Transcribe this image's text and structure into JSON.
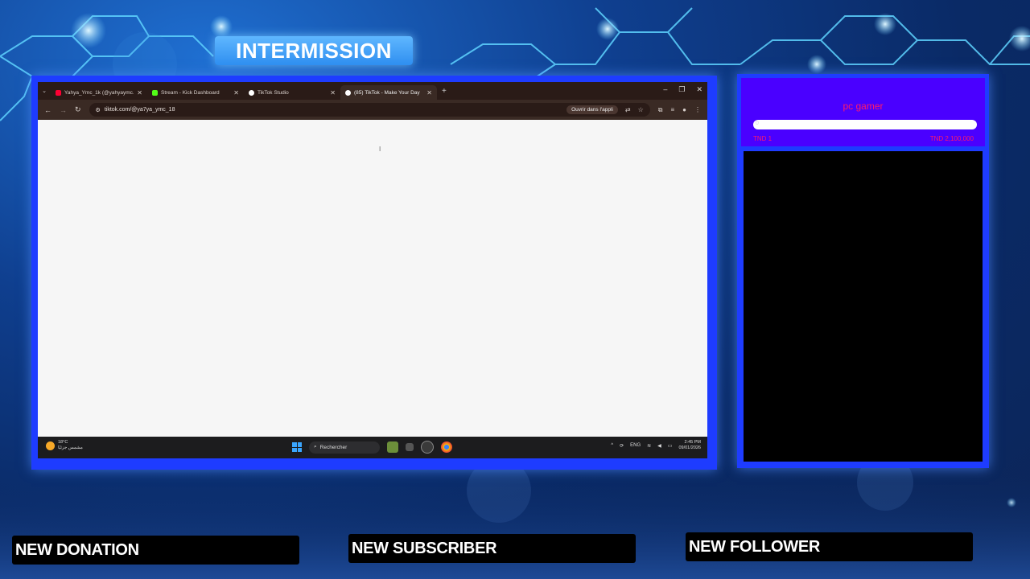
{
  "overlay": {
    "title": "INTERMISSION",
    "alerts": {
      "donation": "NEW DONATION",
      "subscriber": "NEW SUBSCRIBER",
      "follower": "NEW FOLLOWER"
    },
    "goal": {
      "title": "pc gamer",
      "current": "0",
      "progress": 0,
      "start_label": "TND 1",
      "end_label": "TND 2,100,000",
      "accent_color": "#ff1a6a"
    }
  },
  "browser": {
    "tabs": [
      {
        "label": "Yahya_Ymc_1k (@yahyaymc...",
        "icon": "youtube-icon",
        "color": "#ff0033",
        "active": false
      },
      {
        "label": "Stream - Kick Dashboard",
        "icon": "kick-icon",
        "color": "#53fc18",
        "active": false
      },
      {
        "label": "TikTok Studio",
        "icon": "tiktok-icon",
        "color": "#ffffff",
        "active": false
      },
      {
        "label": "(85) TikTok - Make Your Day",
        "icon": "tiktok-icon",
        "color": "#ffffff",
        "active": true
      }
    ],
    "address": "tiktok.com/@ya7ya_ymc_18",
    "open_in_app": "Ouvrir dans l'appli"
  },
  "taskbar": {
    "temperature": "18°C",
    "weather_desc": "مشمس جزئيًا",
    "search_placeholder": "Rechercher",
    "language": "ENG",
    "time": "2:45 PM",
    "date": "09/01/2026"
  },
  "colors": {
    "frame_blue": "#1e3cff",
    "goal_bg": "#4a00ff",
    "banner": "#3fa2f5"
  }
}
